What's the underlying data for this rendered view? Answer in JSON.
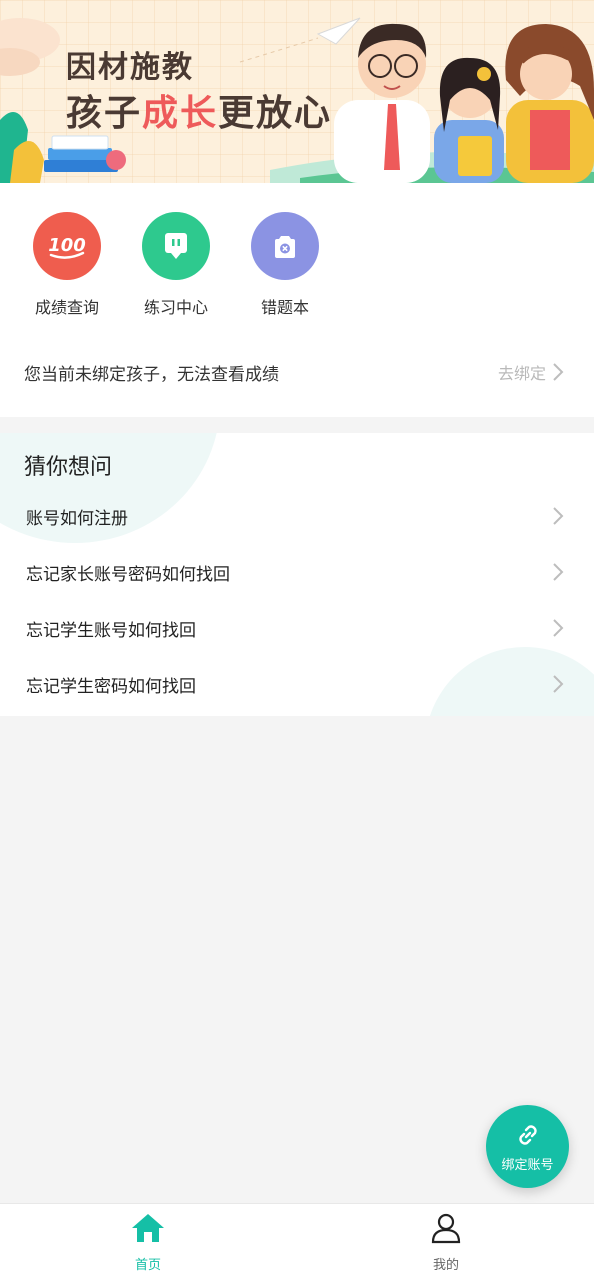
{
  "banner": {
    "title_line1": "因材施教",
    "title_line2_a": "孩子",
    "title_line2_highlight": "成长",
    "title_line2_b": "更放心"
  },
  "quick_actions": [
    {
      "label": "成绩查询",
      "icon": "score-100-icon",
      "color": "#ef5d4e"
    },
    {
      "label": "练习中心",
      "icon": "practice-tv-icon",
      "color": "#2ec98e"
    },
    {
      "label": "错题本",
      "icon": "wrong-book-icon",
      "color": "#8b93e3"
    }
  ],
  "bind_notice": {
    "text": "您当前未绑定孩子，无法查看成绩",
    "link_label": "去绑定"
  },
  "faq": {
    "title": "猜你想问",
    "items": [
      "账号如何注册",
      "忘记家长账号密码如何找回",
      "忘记学生账号如何找回",
      "忘记学生密码如何找回"
    ]
  },
  "fab": {
    "label": "绑定账号",
    "icon": "link-icon",
    "color": "#15bfa6"
  },
  "tabbar": {
    "tabs": [
      {
        "label": "首页",
        "icon": "home-icon",
        "active": true
      },
      {
        "label": "我的",
        "icon": "user-icon",
        "active": false
      }
    ]
  },
  "colors": {
    "accent": "#15bfa6",
    "highlight": "#ee5a5a",
    "background": "#f4f4f4"
  }
}
